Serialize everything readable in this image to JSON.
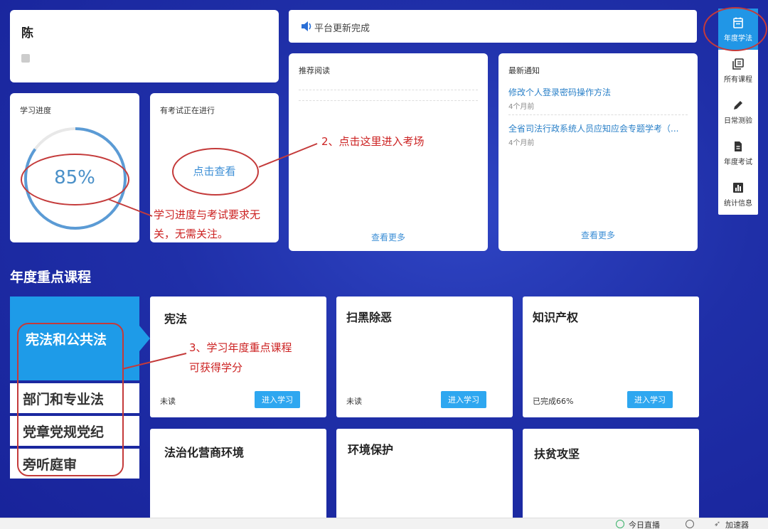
{
  "user": {
    "name": "陈 ",
    "subtitle": ""
  },
  "notice": {
    "text": "平台更新完成"
  },
  "progress": {
    "title": "学习进度",
    "value_text": "85%",
    "percent": 0.85
  },
  "exam": {
    "title": "有考试正在进行",
    "link": "点击查看"
  },
  "reading": {
    "title": "推荐阅读",
    "more": "查看更多"
  },
  "news": {
    "title": "最新通知",
    "items": [
      {
        "text": "修改个人登录密码操作方法",
        "time": "4个月前"
      },
      {
        "text": "全省司法行政系统人员应知应会专题学考（...",
        "time": "4个月前"
      }
    ],
    "more": "查看更多"
  },
  "nav": {
    "items": [
      {
        "label": "年度学法",
        "icon": "calendar-icon"
      },
      {
        "label": "所有课程",
        "icon": "library-icon"
      },
      {
        "label": "日常测验",
        "icon": "pencil-icon"
      },
      {
        "label": "年度考试",
        "icon": "document-icon"
      },
      {
        "label": "统计信息",
        "icon": "bar-chart-icon"
      }
    ]
  },
  "section": {
    "title": "年度重点课程"
  },
  "categories": [
    "宪法和公共法",
    "部门和专业法",
    "党章党规党纪",
    "旁听庭审"
  ],
  "courses": [
    {
      "title": "宪法",
      "status": "未读",
      "button": "进入学习"
    },
    {
      "title": "扫黑除恶",
      "status": "未读",
      "button": "进入学习"
    },
    {
      "title": "知识产权",
      "status": "已完成66%",
      "button": "进入学习"
    },
    {
      "title": "法治化营商环境"
    },
    {
      "title": "环境保护"
    },
    {
      "title": "扶贫攻坚"
    }
  ],
  "annotations": {
    "a1": "学习进度与考试要求无关，无需关注。",
    "a2": "2、点击这里进入考场",
    "a3_line1": "3、学习年度重点课程",
    "a3_line2": "可获得学分"
  },
  "taskbar": {
    "live": "今日直播",
    "accelerator": "加速器"
  },
  "colors": {
    "accent": "#2196e6",
    "button": "#2ea7f0",
    "annotation": "#c43a3a"
  }
}
